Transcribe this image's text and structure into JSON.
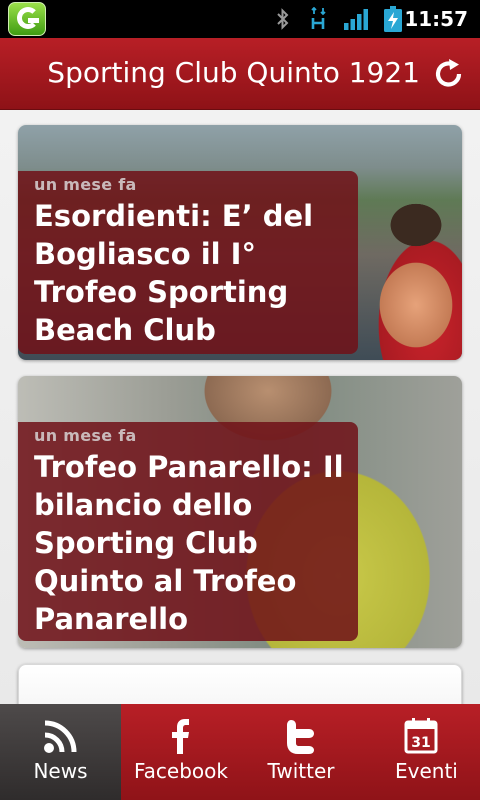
{
  "status_bar": {
    "time": "11:57",
    "icons": [
      "app-launcher-icon",
      "bluetooth-icon",
      "hplus-data-icon",
      "signal-icon",
      "battery-charging-icon"
    ]
  },
  "header": {
    "title": "Sporting Club Quinto 1921",
    "refresh_icon": "refresh-icon",
    "accent": "#b81f26"
  },
  "news": [
    {
      "time_ago": "un mese fa",
      "title": "Esordienti: E’ del Bogliasco il I° Trofeo Sporting Beach Club"
    },
    {
      "time_ago": "un mese fa",
      "title": "Trofeo Panarello: Il bilancio dello Sporting Club Quinto al Trofeo Panarello"
    }
  ],
  "tabs": [
    {
      "label": "News",
      "icon": "rss-icon",
      "selected": true
    },
    {
      "label": "Facebook",
      "icon": "facebook-icon",
      "selected": false
    },
    {
      "label": "Twitter",
      "icon": "twitter-icon",
      "selected": false
    },
    {
      "label": "Eventi",
      "icon": "calendar-icon",
      "calendar_day": "31",
      "selected": false
    }
  ]
}
